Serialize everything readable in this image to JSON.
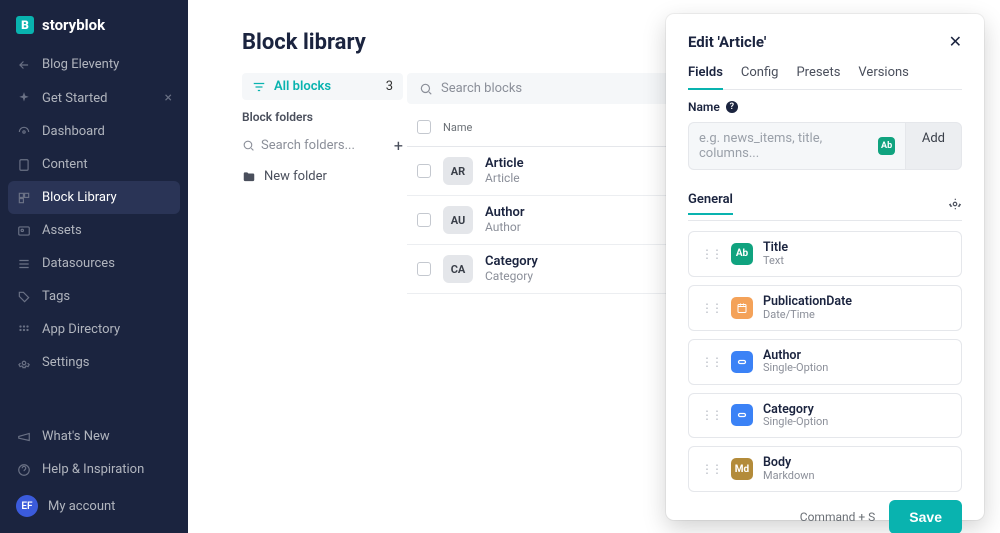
{
  "brand": "storyblok",
  "sidebar": {
    "back": "Blog Eleventy",
    "items": [
      {
        "label": "Get Started",
        "closable": true
      },
      {
        "label": "Dashboard"
      },
      {
        "label": "Content"
      },
      {
        "label": "Block Library",
        "active": true
      },
      {
        "label": "Assets"
      },
      {
        "label": "Datasources"
      },
      {
        "label": "Tags"
      },
      {
        "label": "App Directory"
      },
      {
        "label": "Settings"
      }
    ],
    "footer": [
      {
        "label": "What's New"
      },
      {
        "label": "Help & Inspiration"
      }
    ],
    "account": {
      "initials": "EF",
      "label": "My account"
    }
  },
  "page": {
    "title": "Block library",
    "all_blocks_label": "All blocks",
    "all_blocks_count": "3",
    "block_folders_label": "Block folders",
    "search_folders_placeholder": "Search folders...",
    "new_folder_label": "New folder",
    "search_blocks_placeholder": "Search blocks",
    "name_column": "Name",
    "blocks": [
      {
        "badge": "AR",
        "name": "Article",
        "sub": "Article"
      },
      {
        "badge": "AU",
        "name": "Author",
        "sub": "Author"
      },
      {
        "badge": "CA",
        "name": "Category",
        "sub": "Category"
      }
    ]
  },
  "panel": {
    "title": "Edit 'Article'",
    "tabs": [
      "Fields",
      "Config",
      "Presets",
      "Versions"
    ],
    "active_tab": 0,
    "name_label": "Name",
    "name_placeholder": "e.g. news_items, title, columns...",
    "add_label": "Add",
    "section_label": "General",
    "fields": [
      {
        "name": "Title",
        "type": "Text",
        "icon": "text",
        "glyph": "Ab"
      },
      {
        "name": "PublicationDate",
        "type": "Date/Time",
        "icon": "date",
        "glyph": ""
      },
      {
        "name": "Author",
        "type": "Single-Option",
        "icon": "opt",
        "glyph": ""
      },
      {
        "name": "Category",
        "type": "Single-Option",
        "icon": "opt",
        "glyph": ""
      },
      {
        "name": "Body",
        "type": "Markdown",
        "icon": "md",
        "glyph": "Md"
      }
    ],
    "save_hint": "Command + S",
    "save_label": "Save"
  }
}
